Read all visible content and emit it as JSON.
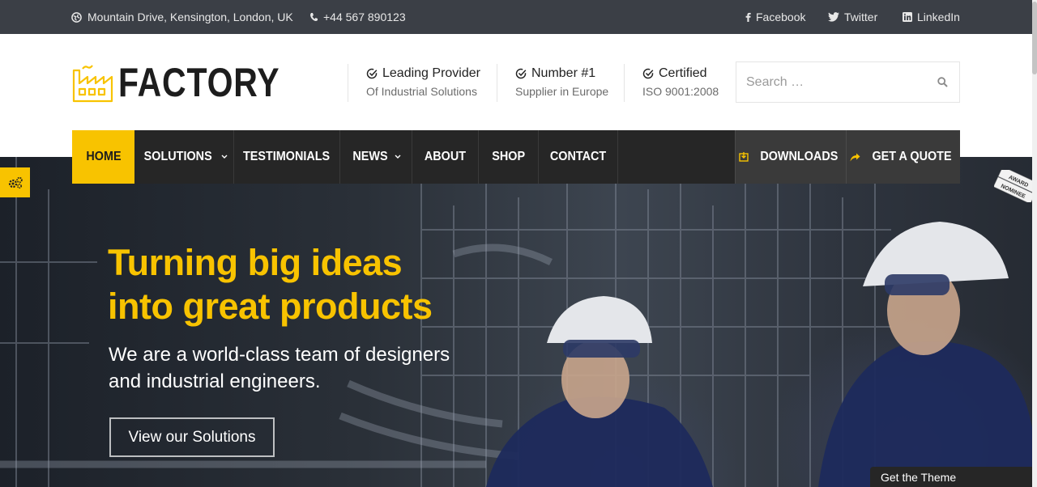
{
  "topbar": {
    "address": "Mountain Drive, Kensington, London, UK",
    "phone": "+44 567 890123",
    "social": [
      {
        "label": "Facebook",
        "icon": "facebook-icon"
      },
      {
        "label": "Twitter",
        "icon": "twitter-icon"
      },
      {
        "label": "LinkedIn",
        "icon": "linkedin-icon"
      }
    ]
  },
  "header": {
    "logo_text": "FACTORY",
    "features": [
      {
        "title": "Leading Provider",
        "subtitle": "Of Industrial Solutions"
      },
      {
        "title": "Number #1",
        "subtitle": "Supplier in Europe"
      },
      {
        "title": "Certified",
        "subtitle": "ISO 9001:2008"
      }
    ],
    "search_placeholder": "Search …"
  },
  "nav": {
    "items": [
      {
        "label": "HOME",
        "active": true
      },
      {
        "label": "SOLUTIONS",
        "dropdown": true
      },
      {
        "label": "TESTIMONIALS"
      },
      {
        "label": "NEWS",
        "dropdown": true
      },
      {
        "label": "ABOUT"
      },
      {
        "label": "SHOP"
      },
      {
        "label": "CONTACT"
      }
    ],
    "right": [
      {
        "label": "DOWNLOADS",
        "icon": "download-icon"
      },
      {
        "label": "GET A QUOTE",
        "icon": "share-arrow-icon"
      }
    ]
  },
  "hero": {
    "title": "Turning big ideas\ninto great products",
    "subtitle": "We are a world-class team of designers\nand industrial engineers.",
    "button": "View our Solutions",
    "award_top": "AWARD",
    "award_bottom": "NOMINEE"
  },
  "footer_tab": {
    "label": "Get the Theme"
  },
  "colors": {
    "accent": "#f8c300",
    "topbar": "#3b3f46",
    "nav": "#262626"
  }
}
